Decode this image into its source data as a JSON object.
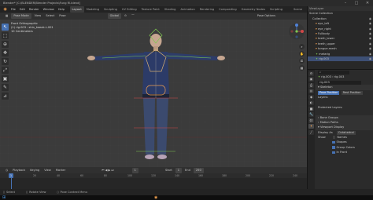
{
  "titlebar": {
    "title": "Blender* [C:\\BLENDER\\Blender Projects\\Fung Rl.blend]",
    "min": "–",
    "max": "□",
    "close": "✕"
  },
  "menu": {
    "items": [
      "File",
      "Edit",
      "Render",
      "Window",
      "Help"
    ],
    "workspaces": [
      "Layout",
      "Modeling",
      "Sculpting",
      "UV Editing",
      "Texture Paint",
      "Shading",
      "Animation",
      "Rendering",
      "Compositing",
      "Geometry Nodes",
      "Scripting"
    ],
    "active_workspace": "Layout",
    "scene_label": "Scene",
    "viewlayer_label": "ViewLayer"
  },
  "viewport_header": {
    "mode": "Pose Mode",
    "view": "View",
    "select": "Select",
    "pose": "Pose",
    "orientation": "Global",
    "pose_options": "Pose Options"
  },
  "viewport_overlay": {
    "line1": "Front Orthographic",
    "line2": "(1) rig.003 : shin_tweak.L.001",
    "line3": "10 Centimeters"
  },
  "toolbar_icons": [
    "cursor-icon",
    "select-box-icon",
    "cursor-3d-icon",
    "move-icon",
    "rotate-icon",
    "scale-icon",
    "transform-icon",
    "annotate-icon",
    "measure-icon"
  ],
  "outliner": {
    "header": "Scene Collection",
    "rows": [
      {
        "label": "Scene Collection",
        "indent": 0
      },
      {
        "label": "Collection",
        "indent": 1
      },
      {
        "label": "eye_left",
        "indent": 2
      },
      {
        "label": "eye_right",
        "indent": 2
      },
      {
        "label": "Fullbody",
        "indent": 2
      },
      {
        "label": "teeth_lower",
        "indent": 2
      },
      {
        "label": "teeth_upper",
        "indent": 2
      },
      {
        "label": "tongue.mesh",
        "indent": 2
      },
      {
        "label": "metarig",
        "indent": 2
      },
      {
        "label": "rig.003",
        "indent": 2,
        "selected": true
      }
    ]
  },
  "properties": {
    "object_field": "rig.003",
    "data_field": "rig.003",
    "name_field": "rig.003",
    "skeleton_header": "Skeleton",
    "pose_position": "Pose Position",
    "rest_position": "Rest Position",
    "layers_label": "Layers:",
    "protected_label": "Protected Layers:",
    "bone_groups": "Bone Groups",
    "motion_paths": "Motion Paths",
    "viewport_display": "Viewport Display",
    "display_as_label": "Display As",
    "display_as_value": "Octahedral",
    "show_label": "Show",
    "show_names": "Names",
    "show_shapes": "Shapes",
    "show_group_colors": "Group Colors",
    "show_in_front": "In Front"
  },
  "timeline": {
    "menus": [
      "Playback",
      "Keying",
      "View",
      "Marker"
    ],
    "current_frame": "1",
    "start_label": "Start",
    "start": "1",
    "end_label": "End",
    "end": "250",
    "ticks": [
      "0",
      "20",
      "40",
      "60",
      "80",
      "100",
      "120",
      "140",
      "160",
      "180",
      "200",
      "220",
      "240"
    ]
  },
  "statusbar": {
    "select": "Select",
    "rotate_view": "Rotate View",
    "context_menu": "Pose Context Menu"
  },
  "colors": {
    "accent": "#4772b3",
    "bone_active": "#f0a050",
    "bone_green": "#7ec850",
    "viewport_bg": "#3b3b3b"
  }
}
